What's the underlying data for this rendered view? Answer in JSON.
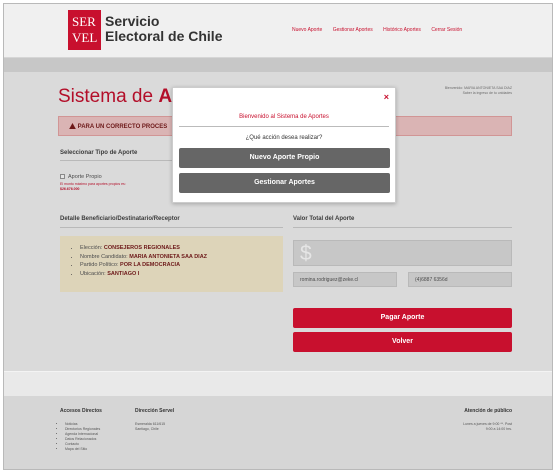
{
  "header": {
    "logo_line1": "SER",
    "logo_line2": "VEL",
    "brand_line1": "Servicio",
    "brand_line2": "Electoral de Chile",
    "nav": [
      "Nuevo Aporte",
      "Gestionar Aportes",
      "Histórico Aportes",
      "Cerrar Sesión"
    ]
  },
  "page": {
    "title_prefix": "Sistema de ",
    "title_bold": "Apo",
    "user_info_line1": "Bienvenido: MARIA ANTONIETA SAA DIAZ",
    "user_info_line2": "Saber la ingreso de tu unidades",
    "alert": "PARA UN CORRECTO PROCES",
    "seleccionar_label": "Seleccionar Tipo de Aporte",
    "aporte_propio_label": "Aporte Propio",
    "aporte_propio_note1": "El monto máximo para aportes propios es:",
    "aporte_propio_note2": "$26.676.000",
    "detalle_label": "Detalle Beneficiario/Destinatario/Receptor",
    "valor_label": "Valor Total del Aporte",
    "detalle_items": [
      {
        "label": "Elección: ",
        "value": "CONSEJEROS REGIONALES"
      },
      {
        "label": "Nombre Candidato: ",
        "value": "MARIA ANTONIETA SAA DIAZ"
      },
      {
        "label": "Partido Político: ",
        "value": "POR LA DEMOCRACIA"
      },
      {
        "label": "Ubicación: ",
        "value": "SANTIAGO I"
      }
    ],
    "currency_symbol": "$",
    "email_value": "romina.rodriguez@zeke.cl",
    "phone_value": "(4)6887 6356d",
    "pagar_button": "Pagar Aporte",
    "volver_button": "Volver"
  },
  "modal": {
    "close_symbol": "×",
    "title": "Bienvenido al Sistema de Aportes",
    "question": "¿Qué acción desea realizar?",
    "btn_nuevo": "Nuevo Aporte Propio",
    "btn_gestionar": "Gestionar Aportes"
  },
  "footer": {
    "accesos_title": "Accesos Directos",
    "accesos_items": [
      "Noticias",
      "Directorios Regionales",
      "Agenda Internacional",
      "Datos Relacionados",
      "Contacto",
      "Mapa del Sitio"
    ],
    "direccion_title": "Dirección Servel",
    "direccion_line1": "Esmeralda 611/615",
    "direccion_line2": "Santiago, Chile",
    "atencion_title": "Atención de público",
    "atencion_line1": "Lunes a jueves de 9:00 **. Post",
    "atencion_line2": "9:00 a 14:00 hrs."
  }
}
